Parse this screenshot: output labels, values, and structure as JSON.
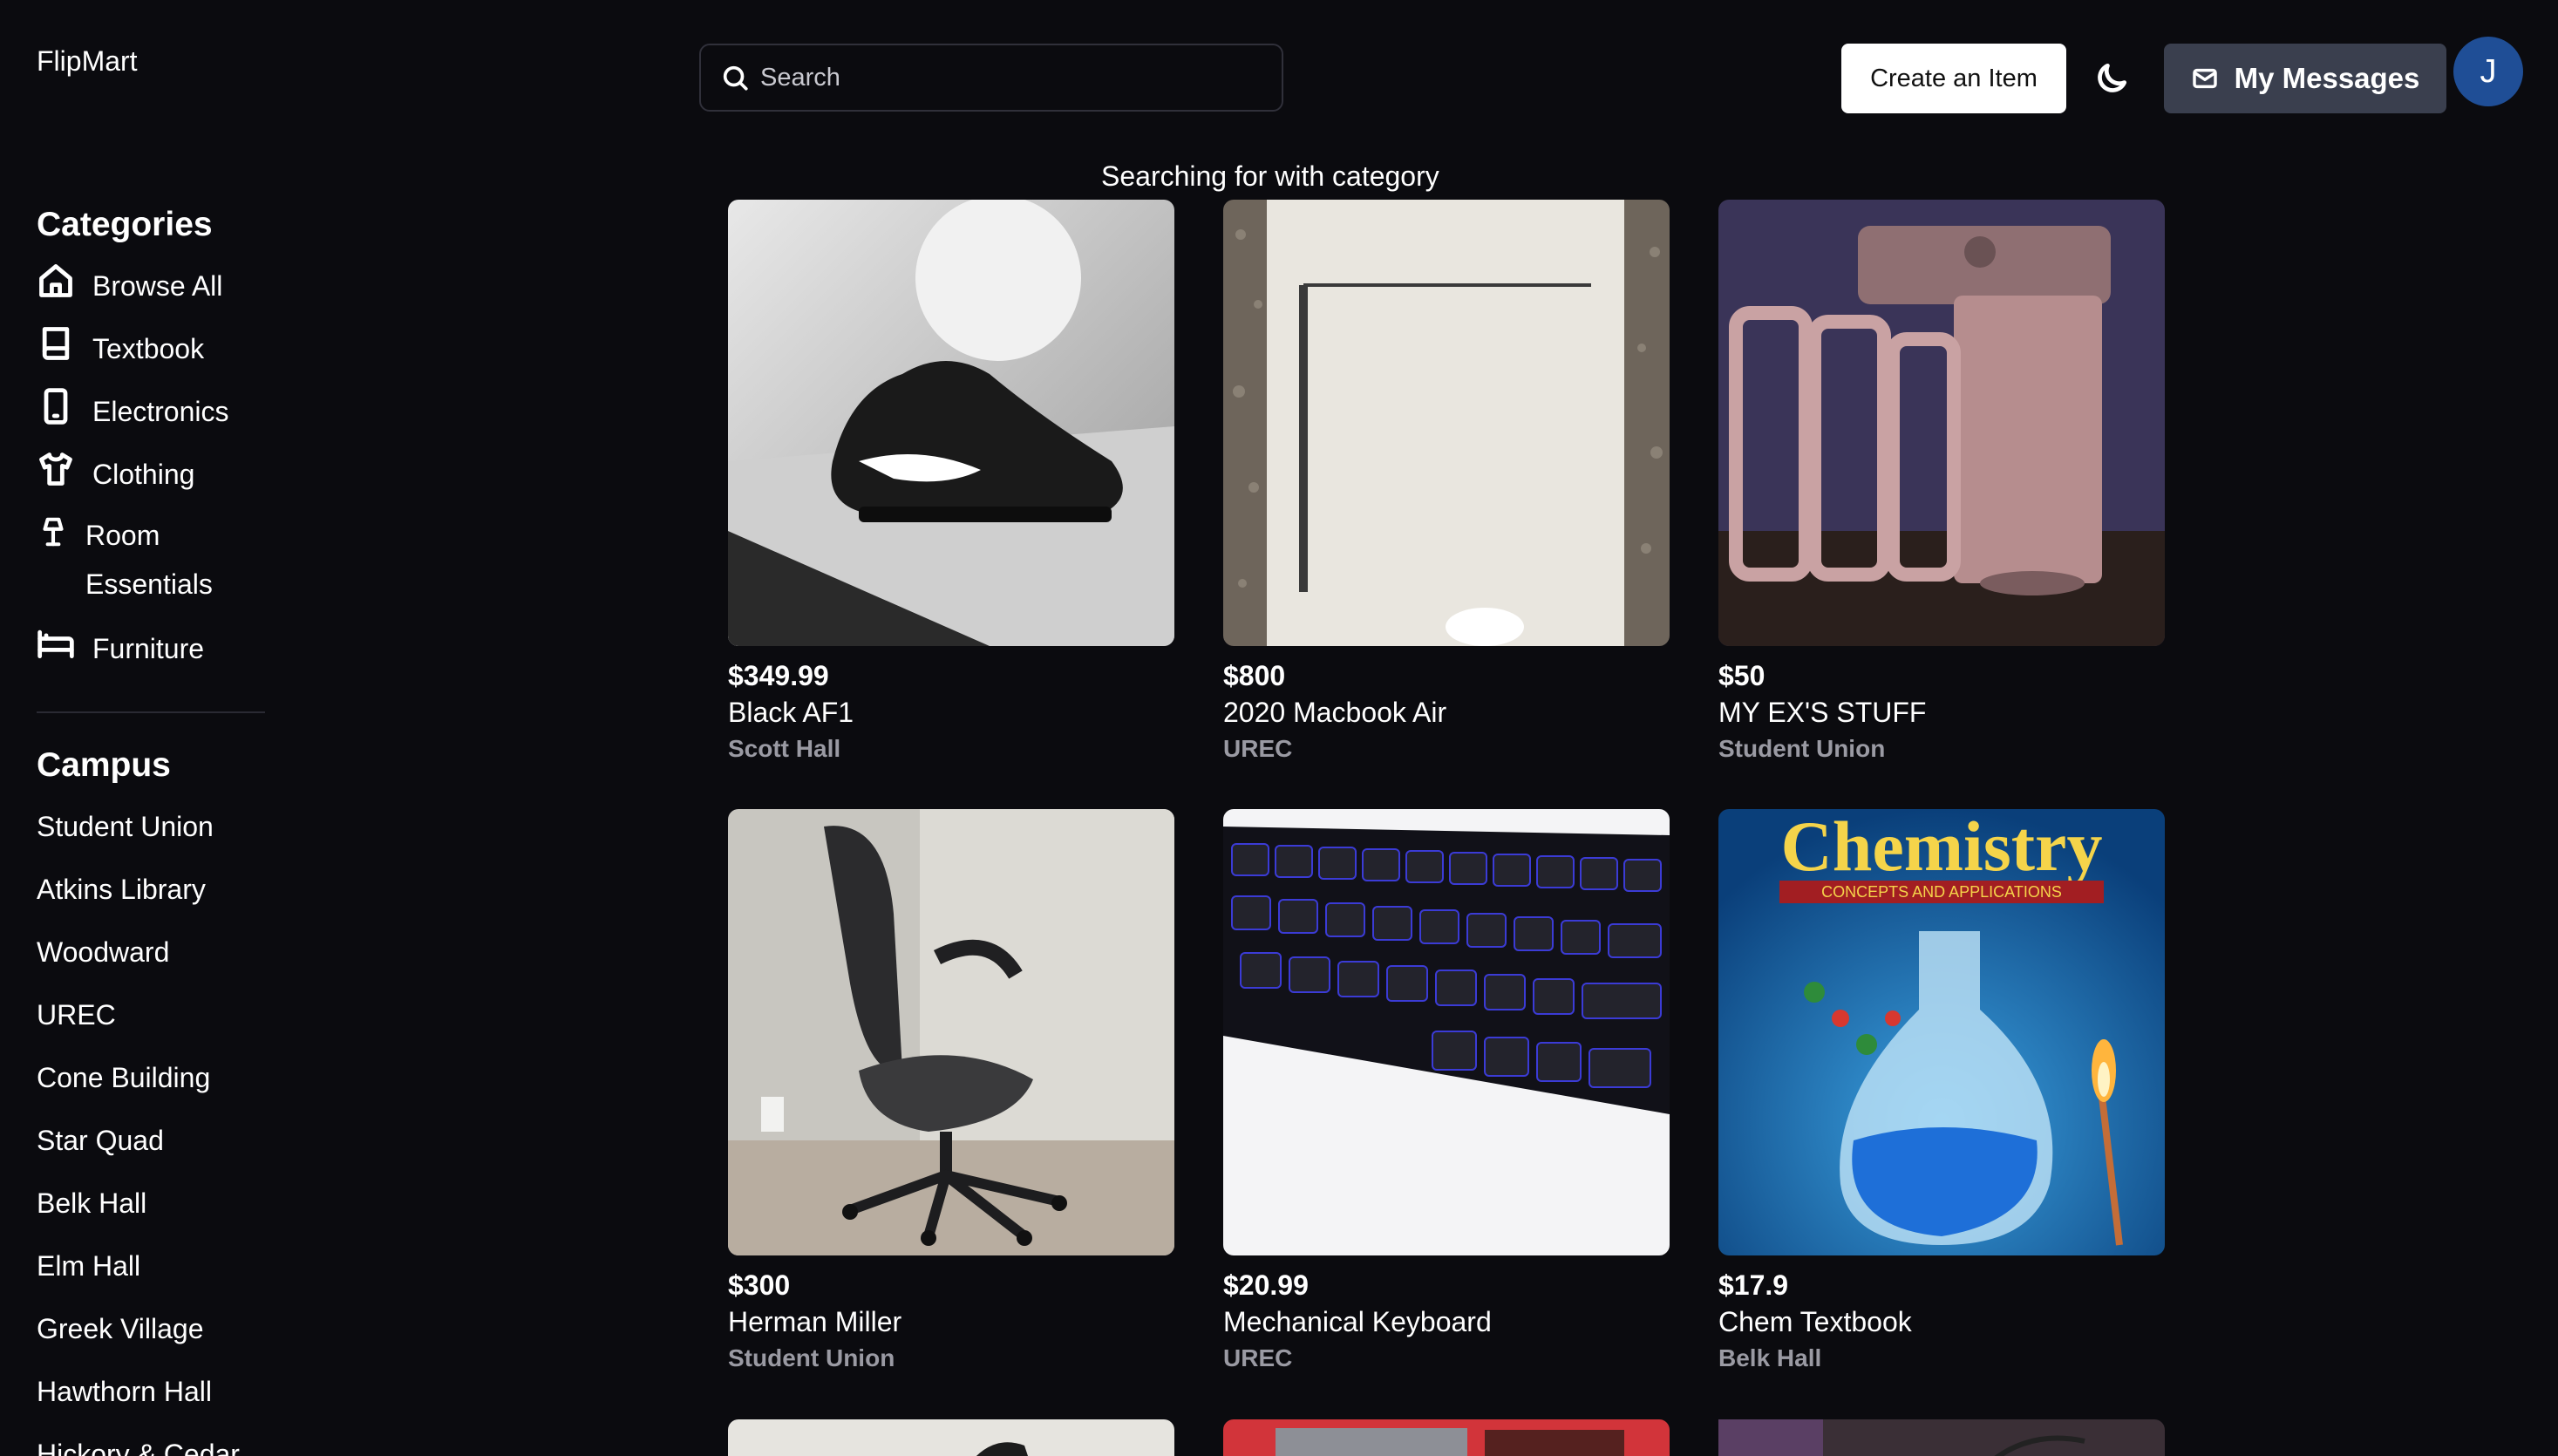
{
  "brand": "FlipMart",
  "search": {
    "placeholder": "Search"
  },
  "header": {
    "create_label": "Create an Item",
    "messages_label": "My Messages",
    "avatar_initial": "J"
  },
  "sidebar": {
    "categories_title": "Categories",
    "categories": [
      {
        "label": "Browse All",
        "icon": "home-icon"
      },
      {
        "label": "Textbook",
        "icon": "book-icon"
      },
      {
        "label": "Electronics",
        "icon": "phone-icon"
      },
      {
        "label": "Clothing",
        "icon": "shirt-icon"
      },
      {
        "label": "Room Essentials",
        "icon": "lamp-icon"
      },
      {
        "label": "Furniture",
        "icon": "bed-icon"
      }
    ],
    "campus_title": "Campus",
    "campus": [
      "Student Union",
      "Atkins Library",
      "Woodward",
      "UREC",
      "Cone Building",
      "Star Quad",
      "Belk Hall",
      "Elm Hall",
      "Greek Village",
      "Hawthorn Hall",
      "Hickory & Cedar"
    ]
  },
  "main": {
    "status_text": "Searching for with category",
    "items": [
      {
        "price": "$349.99",
        "title": "Black AF1",
        "location": "Scott Hall"
      },
      {
        "price": "$800",
        "title": "2020 Macbook Air",
        "location": "UREC"
      },
      {
        "price": "$50",
        "title": "MY EX'S STUFF",
        "location": "Student Union"
      },
      {
        "price": "$300",
        "title": "Herman Miller",
        "location": "Student Union"
      },
      {
        "price": "$20.99",
        "title": "Mechanical Keyboard",
        "location": "UREC"
      },
      {
        "price": "$17.9",
        "title": "Chem Textbook",
        "location": "Belk Hall"
      }
    ],
    "chem_cover_title": "Chemistry",
    "chem_cover_subtitle": "CONCEPTS AND APPLICATIONS"
  }
}
